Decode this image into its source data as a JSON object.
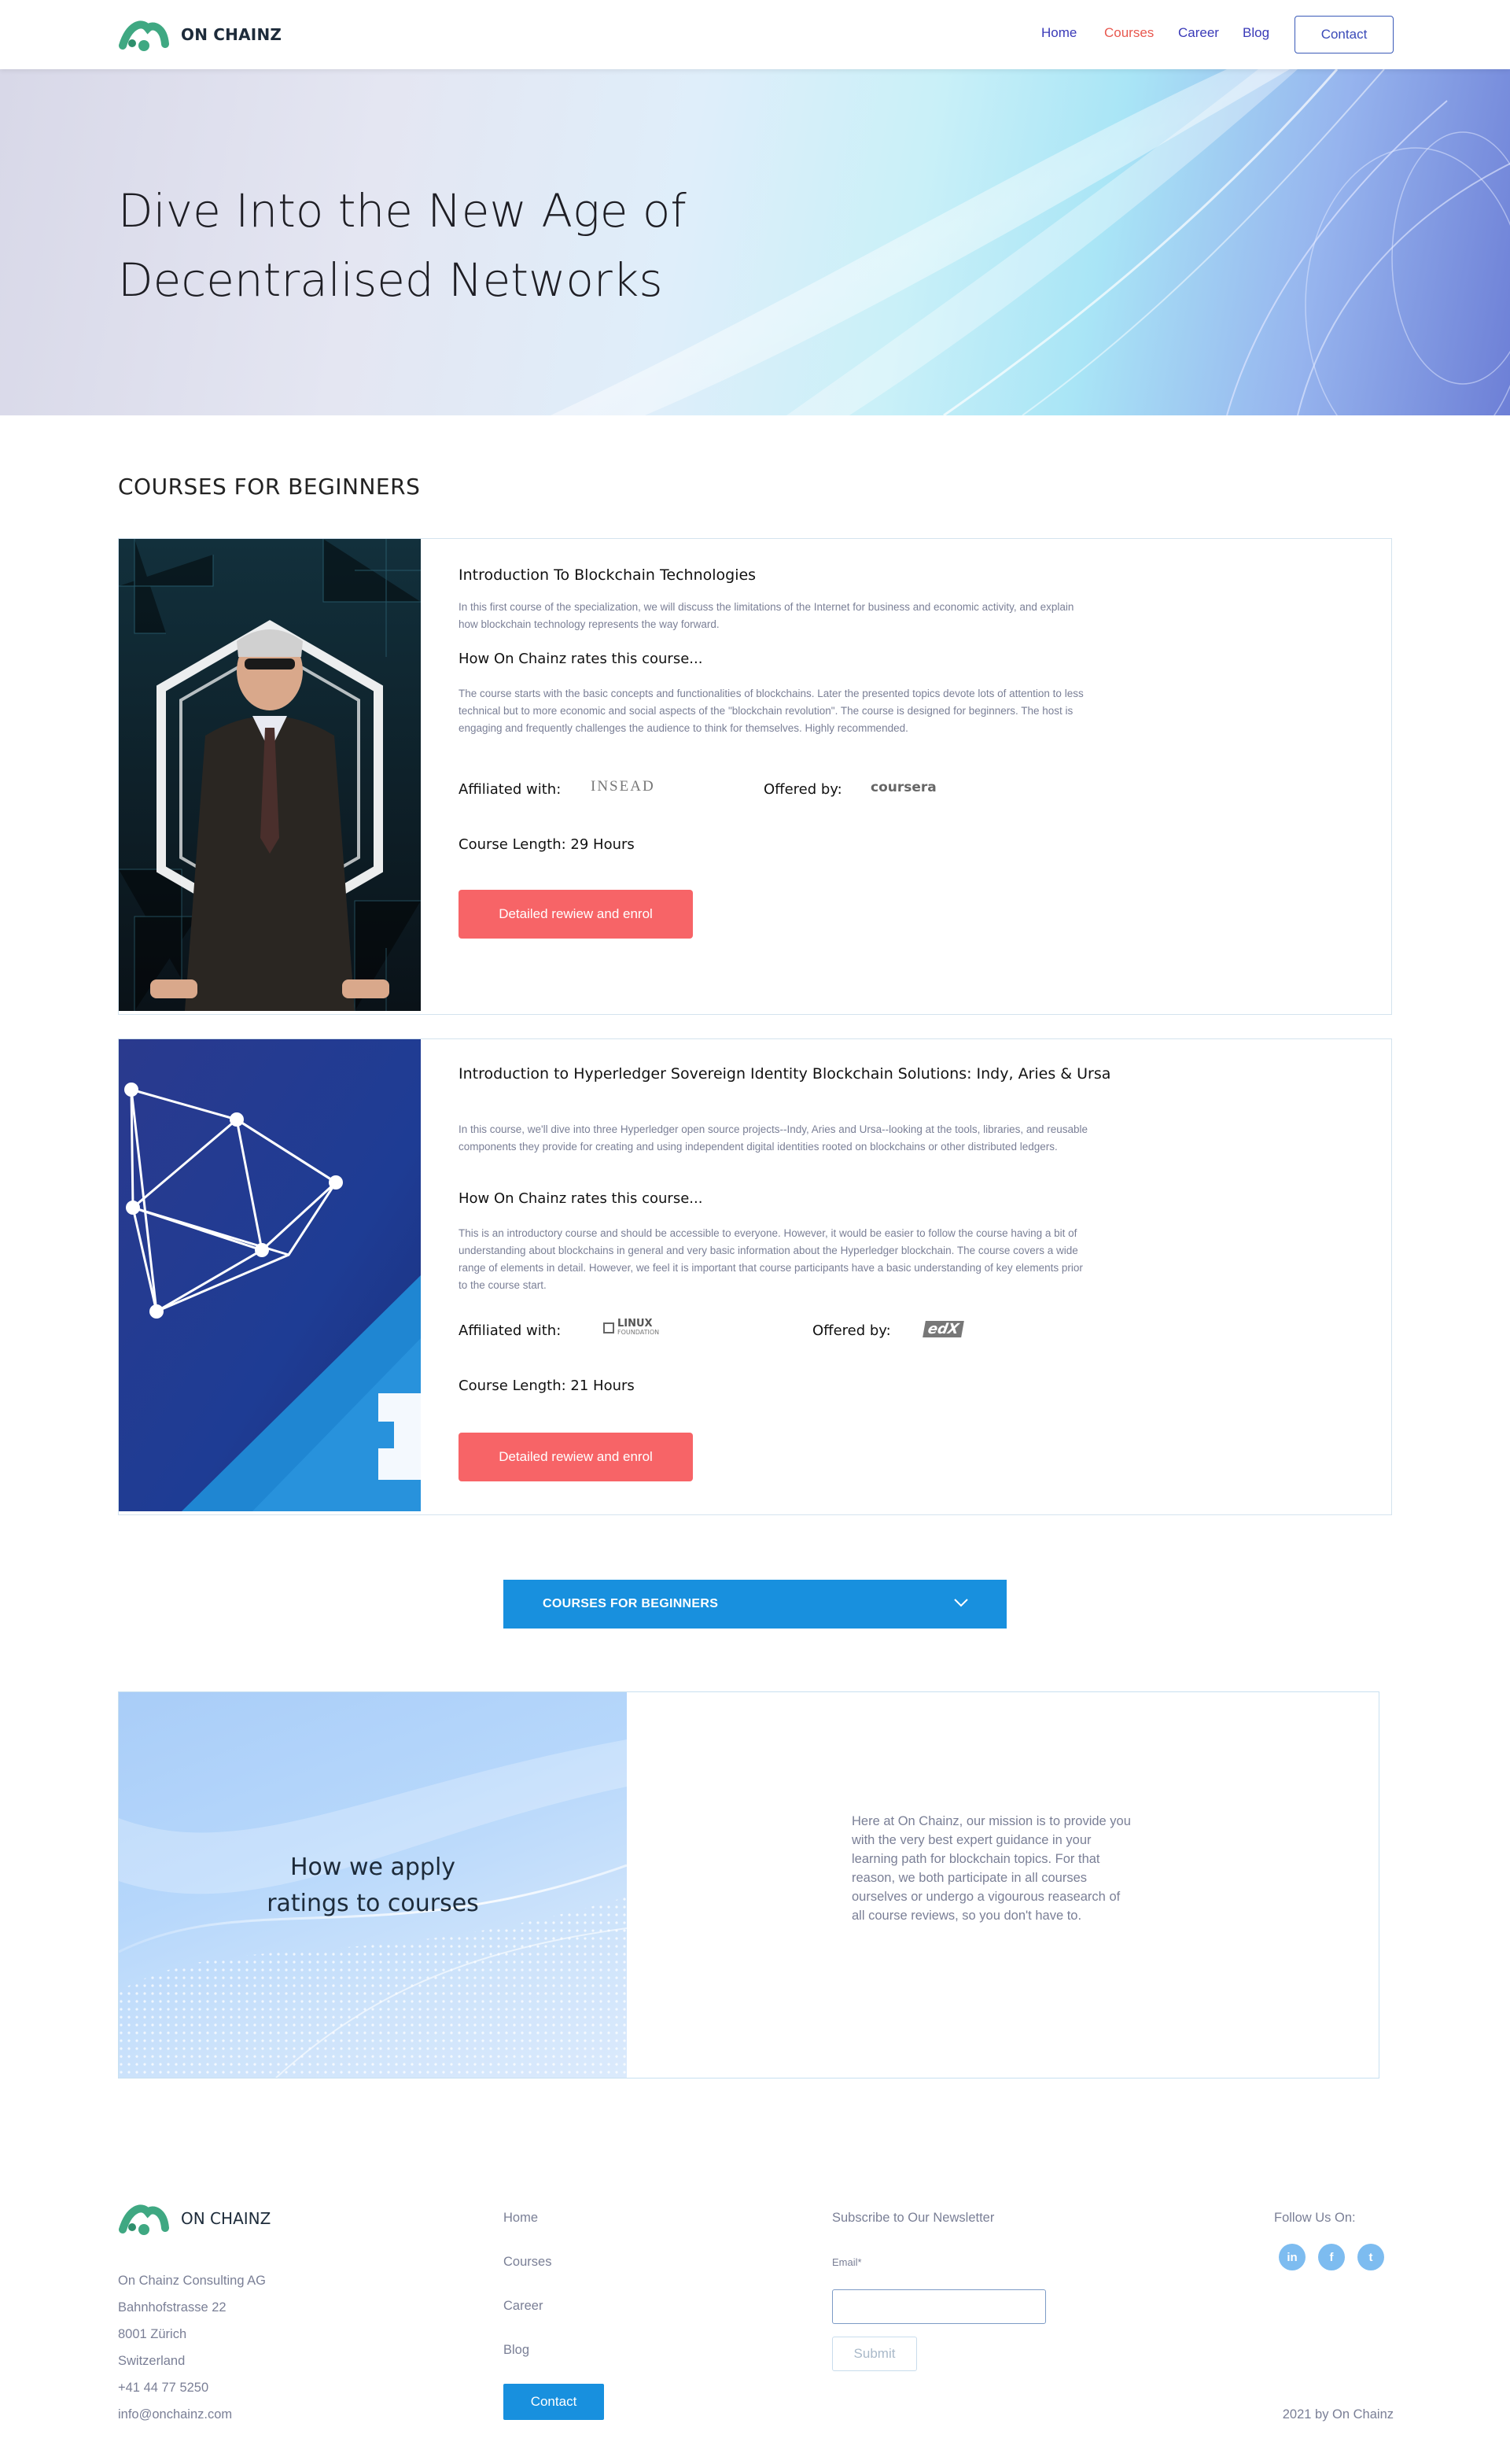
{
  "header": {
    "brand": "ON CHAINZ",
    "nav": [
      {
        "label": "Home",
        "active": false
      },
      {
        "label": "Courses",
        "active": true
      },
      {
        "label": "Career",
        "active": false
      },
      {
        "label": "Blog",
        "active": false
      }
    ],
    "contact_label": "Contact"
  },
  "hero": {
    "title_line1": "Dive Into the New Age of",
    "title_line2": "Decentralised Networks"
  },
  "section_title": "COURSES FOR BEGINNERS",
  "courses": [
    {
      "title": "Introduction To Blockchain Technologies",
      "description": "In this first course of the specialization, we will discuss the limitations of the Internet for business and economic activity, and explain how blockchain technology represents the way forward.",
      "rates_title": "How On Chainz rates this course...",
      "review": "The course starts with the basic concepts and functionalities of blockchains. Later the presented topics devote lots of attention to less technical but to more economic and social aspects of the \"blockchain revolution\". The course is designed for beginners. The host is engaging and frequently challenges the audience to think for themselves. Highly recommended.",
      "affiliated_label": "Affiliated with:",
      "affiliated_logo": "INSEAD",
      "offered_label": "Offered by:",
      "offered_logo": "coursera",
      "length": "Course Length: 29 Hours",
      "button": "Detailed rewiew and enrol"
    },
    {
      "title": "Introduction to Hyperledger Sovereign Identity Blockchain Solutions: Indy, Aries & Ursa",
      "description": "In this course, we'll dive into three Hyperledger open source projects--Indy, Aries and Ursa--looking at the tools, libraries, and reusable components they provide for creating and using independent digital identities rooted on blockchains or other distributed ledgers.",
      "rates_title": "How On Chainz rates this course...",
      "review": "This is an introductory course and should be accessible to everyone. However, it would be easier to follow the course having a bit of understanding about blockchains in general and very basic information about the Hyperledger blockchain. The course covers a wide range of elements in detail. However, we feel it is important that course participants have a basic understanding of key elements prior to the course start.",
      "affiliated_label": "Affiliated with:",
      "affiliated_logo": "LINUX",
      "affiliated_logo_sub": "FOUNDATION",
      "offered_label": "Offered by:",
      "offered_logo": "edX",
      "length": "Course Length: 21 Hours",
      "button": "Detailed rewiew and enrol"
    }
  ],
  "dropdown": {
    "label": "COURSES FOR BEGINNERS",
    "icon": "chevron-down-icon"
  },
  "ratings": {
    "heading_line1": "How we apply",
    "heading_line2": "ratings to courses",
    "text": "Here at On Chainz, our mission is to provide you with the very best expert guidance in your learning path for blockchain topics. For that reason, we both participate in all courses ourselves or undergo a vigourous reasearch of all course reviews, so you don't have to."
  },
  "footer": {
    "brand": "ON CHAINZ",
    "address": [
      "On Chainz Consulting AG",
      "Bahnhofstrasse 22",
      "8001 Zürich",
      "Switzerland",
      "+41 44 77 5250",
      "info@onchainz.com"
    ],
    "links": [
      "Home",
      "Courses",
      "Career",
      "Blog"
    ],
    "contact_label": "Contact",
    "newsletter_title": "Subscribe to Our Newsletter",
    "email_label": "Email*",
    "email_value": "",
    "submit_label": "Submit",
    "follow_label": "Follow Us On:",
    "social": [
      {
        "name": "linkedin-icon",
        "glyph": "in"
      },
      {
        "name": "facebook-icon",
        "glyph": "f"
      },
      {
        "name": "twitter-icon",
        "glyph": "t"
      }
    ],
    "copyright": "2021 by On Chainz"
  },
  "colors": {
    "accent_blue": "#1890de",
    "enrol_red": "#f76467",
    "nav_active": "#e8584f",
    "nav": "#3a3ab8"
  }
}
